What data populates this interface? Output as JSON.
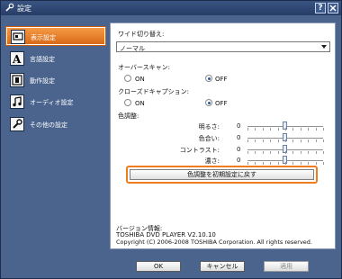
{
  "window": {
    "title": "設定"
  },
  "sidebar": {
    "items": [
      {
        "label": "表示設定",
        "icon": "display-icon",
        "active": true
      },
      {
        "label": "言語設定",
        "icon": "language-A-icon",
        "active": false
      },
      {
        "label": "動作設定",
        "icon": "film-icon",
        "active": false
      },
      {
        "label": "オーディオ設定",
        "icon": "music-note-icon",
        "active": false
      },
      {
        "label": "その他の設定",
        "icon": "wrench-icon",
        "active": false
      }
    ]
  },
  "panel": {
    "wide_label": "ワイド切り替え:",
    "wide_value": "ノーマル",
    "overscan": {
      "label": "オーバースキャン:",
      "on": "ON",
      "off": "OFF",
      "selected": "OFF"
    },
    "cc": {
      "label": "クローズドキャプション:",
      "on": "ON",
      "off": "OFF",
      "selected": "OFF"
    },
    "color_label": "色調整:",
    "sliders": [
      {
        "label": "明るさ:",
        "value": "0"
      },
      {
        "label": "色合い:",
        "value": "0"
      },
      {
        "label": "コントラスト:",
        "value": "0"
      },
      {
        "label": "濃さ:",
        "value": "0"
      }
    ],
    "reset_label": "色調整を初期設定に戻す",
    "version_heading": "バージョン情報:",
    "version_line": "TOSHIBA DVD PLAYER  V2.10.10",
    "copyright": "Copyright (C) 2006-2008 TOSHIBA Corporation. All rights reserved."
  },
  "buttons": {
    "ok": "OK",
    "cancel": "キャンセル",
    "apply": "適用"
  },
  "colors": {
    "accent": "#ee7d1f",
    "window_bg": "#4b648e",
    "titlebar": "#263d66"
  }
}
